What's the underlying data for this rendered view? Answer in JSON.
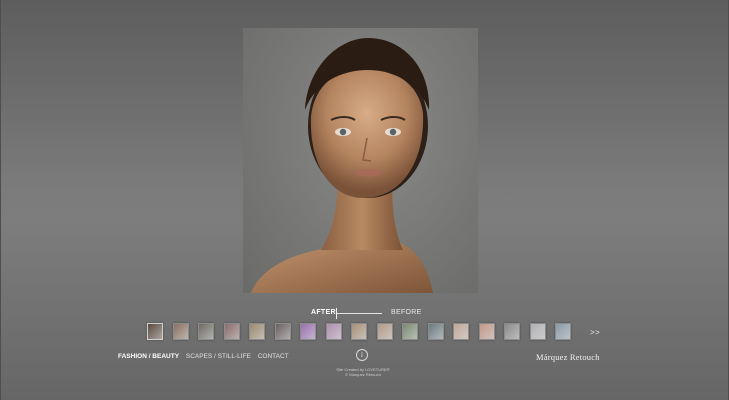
{
  "compare": {
    "after_label": "AFTER",
    "before_label": "BEFORE"
  },
  "thumbnails": [
    {
      "name": "thumb-1",
      "color": "#5a4a40",
      "selected": true
    },
    {
      "name": "thumb-2",
      "color": "#8a7060"
    },
    {
      "name": "thumb-3",
      "color": "#6e6a62"
    },
    {
      "name": "thumb-4",
      "color": "#8a6a6a"
    },
    {
      "name": "thumb-5",
      "color": "#9a8a70"
    },
    {
      "name": "thumb-6",
      "color": "#6a6060"
    },
    {
      "name": "thumb-7",
      "color": "#9a70b0"
    },
    {
      "name": "thumb-8",
      "color": "#b090b0"
    },
    {
      "name": "thumb-9",
      "color": "#a89078"
    },
    {
      "name": "thumb-10",
      "color": "#b09a88"
    },
    {
      "name": "thumb-11",
      "color": "#7a8a70"
    },
    {
      "name": "thumb-12",
      "color": "#6a7a80"
    },
    {
      "name": "thumb-13",
      "color": "#c0a898"
    },
    {
      "name": "thumb-14",
      "color": "#c09888"
    },
    {
      "name": "thumb-15",
      "color": "#8a8a8a"
    },
    {
      "name": "thumb-16",
      "color": "#b0b0b4"
    },
    {
      "name": "thumb-17",
      "color": "#8a9aa8"
    }
  ],
  "next_label": ">>",
  "nav": {
    "fashion": "FASHION / BEAUTY",
    "scapes": "SCAPES / STILL-LIFE",
    "contact": "CONTACT"
  },
  "info_label": "i",
  "credits": {
    "line1": "Site Created by LOVETURE®",
    "line2": "© Marquez Retouch"
  },
  "brand": "Márquez Retouch",
  "colors": {
    "background": "#7a7a7a",
    "text": "#ffffff"
  }
}
